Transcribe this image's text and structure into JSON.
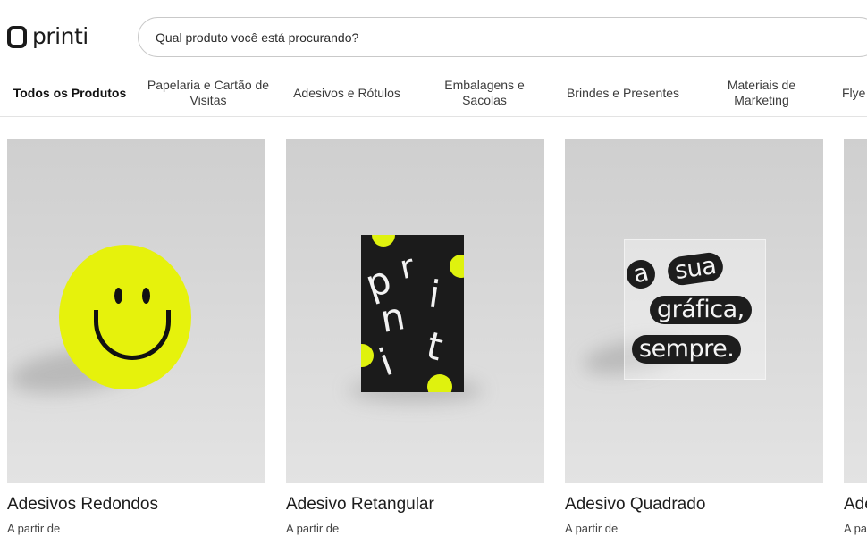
{
  "brand": {
    "name": "printi"
  },
  "search": {
    "placeholder": "Qual produto você está procurando?"
  },
  "nav": {
    "items": [
      {
        "label": "Todos os Produtos",
        "active": true
      },
      {
        "label": "Papelaria e Cartão de Visitas"
      },
      {
        "label": "Adesivos e Rótulos"
      },
      {
        "label": "Embalagens e Sacolas"
      },
      {
        "label": "Brindes e Presentes"
      },
      {
        "label": "Materiais de Marketing"
      },
      {
        "label": "Flye"
      }
    ]
  },
  "products": [
    {
      "title": "Adesivos Redondos",
      "subtitle": "A partir de"
    },
    {
      "title": "Adesivo Retangular",
      "subtitle": "A partir de",
      "art_letters": [
        "p",
        "r",
        "i",
        "n",
        "t",
        "i"
      ]
    },
    {
      "title": "Adesivo Quadrado",
      "subtitle": "A partir de",
      "art_words": [
        "a",
        "sua",
        "gráfica,",
        "sempre."
      ]
    },
    {
      "title": "Ade",
      "subtitle": "A pa"
    }
  ],
  "colors": {
    "accent": "#e6f20c",
    "sticker_dark": "#1b1b1b",
    "photo_bg": "#d8d8d8"
  }
}
